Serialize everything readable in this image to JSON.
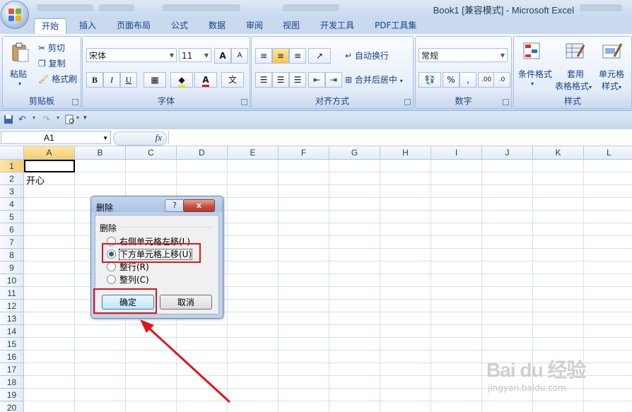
{
  "window": {
    "title": "Book1  [兼容模式] - Microsoft Excel"
  },
  "tabs": [
    "开始",
    "插入",
    "页面布局",
    "公式",
    "数据",
    "审阅",
    "视图",
    "开发工具",
    "PDF工具集"
  ],
  "ribbon": {
    "clipboard": {
      "paste": "粘贴",
      "cut": "剪切",
      "copy": "复制",
      "format_painter": "格式刷",
      "group_label": "剪贴板"
    },
    "font": {
      "font_name": "宋体",
      "font_size": "11",
      "bold": "B",
      "italic": "I",
      "underline": "U",
      "grow": "A",
      "shrink": "A",
      "font_color": "A",
      "phonetic": "文",
      "group_label": "字体"
    },
    "alignment": {
      "wrap_text": "自动换行",
      "merge_center": "合并后居中",
      "group_label": "对齐方式"
    },
    "number": {
      "format": "常规",
      "percent": "%",
      "comma": ",",
      "group_label": "数字"
    },
    "styles": {
      "conditional_format": "条件格式",
      "table_format_top": "套用",
      "table_format_bottom": "表格格式",
      "cell_styles_top": "单元格",
      "cell_styles_bottom": "样式",
      "group_label": "样式"
    }
  },
  "formula_bar": {
    "name_box": "A1",
    "fx": "fx",
    "content": ""
  },
  "grid": {
    "columns": [
      "A",
      "B",
      "C",
      "D",
      "E",
      "F",
      "G",
      "H",
      "I",
      "J",
      "K",
      "L"
    ],
    "rows": [
      "1",
      "2",
      "3",
      "4",
      "5",
      "6",
      "7",
      "8",
      "9",
      "10",
      "11",
      "12",
      "13",
      "14",
      "15",
      "16",
      "17",
      "18",
      "19",
      "20"
    ],
    "selected_cell": "A1",
    "cells": {
      "A2": "开心"
    }
  },
  "dialog": {
    "title": "删除",
    "help": "?",
    "close": "x",
    "group_label": "删除",
    "options": [
      {
        "label": "右侧单元格左移(L)",
        "selected": false
      },
      {
        "label": "下方单元格上移(U)",
        "selected": true
      },
      {
        "label": "整行(R)",
        "selected": false
      },
      {
        "label": "整列(C)",
        "selected": false
      }
    ],
    "ok": "确定",
    "cancel": "取消"
  },
  "watermark": {
    "brand": "Bai du 经验",
    "url": "jingyan.baidu.com"
  },
  "colors": {
    "highlight": "#e0141c",
    "selection_header": "#f7cd6e",
    "ribbon_text": "#15428b"
  }
}
